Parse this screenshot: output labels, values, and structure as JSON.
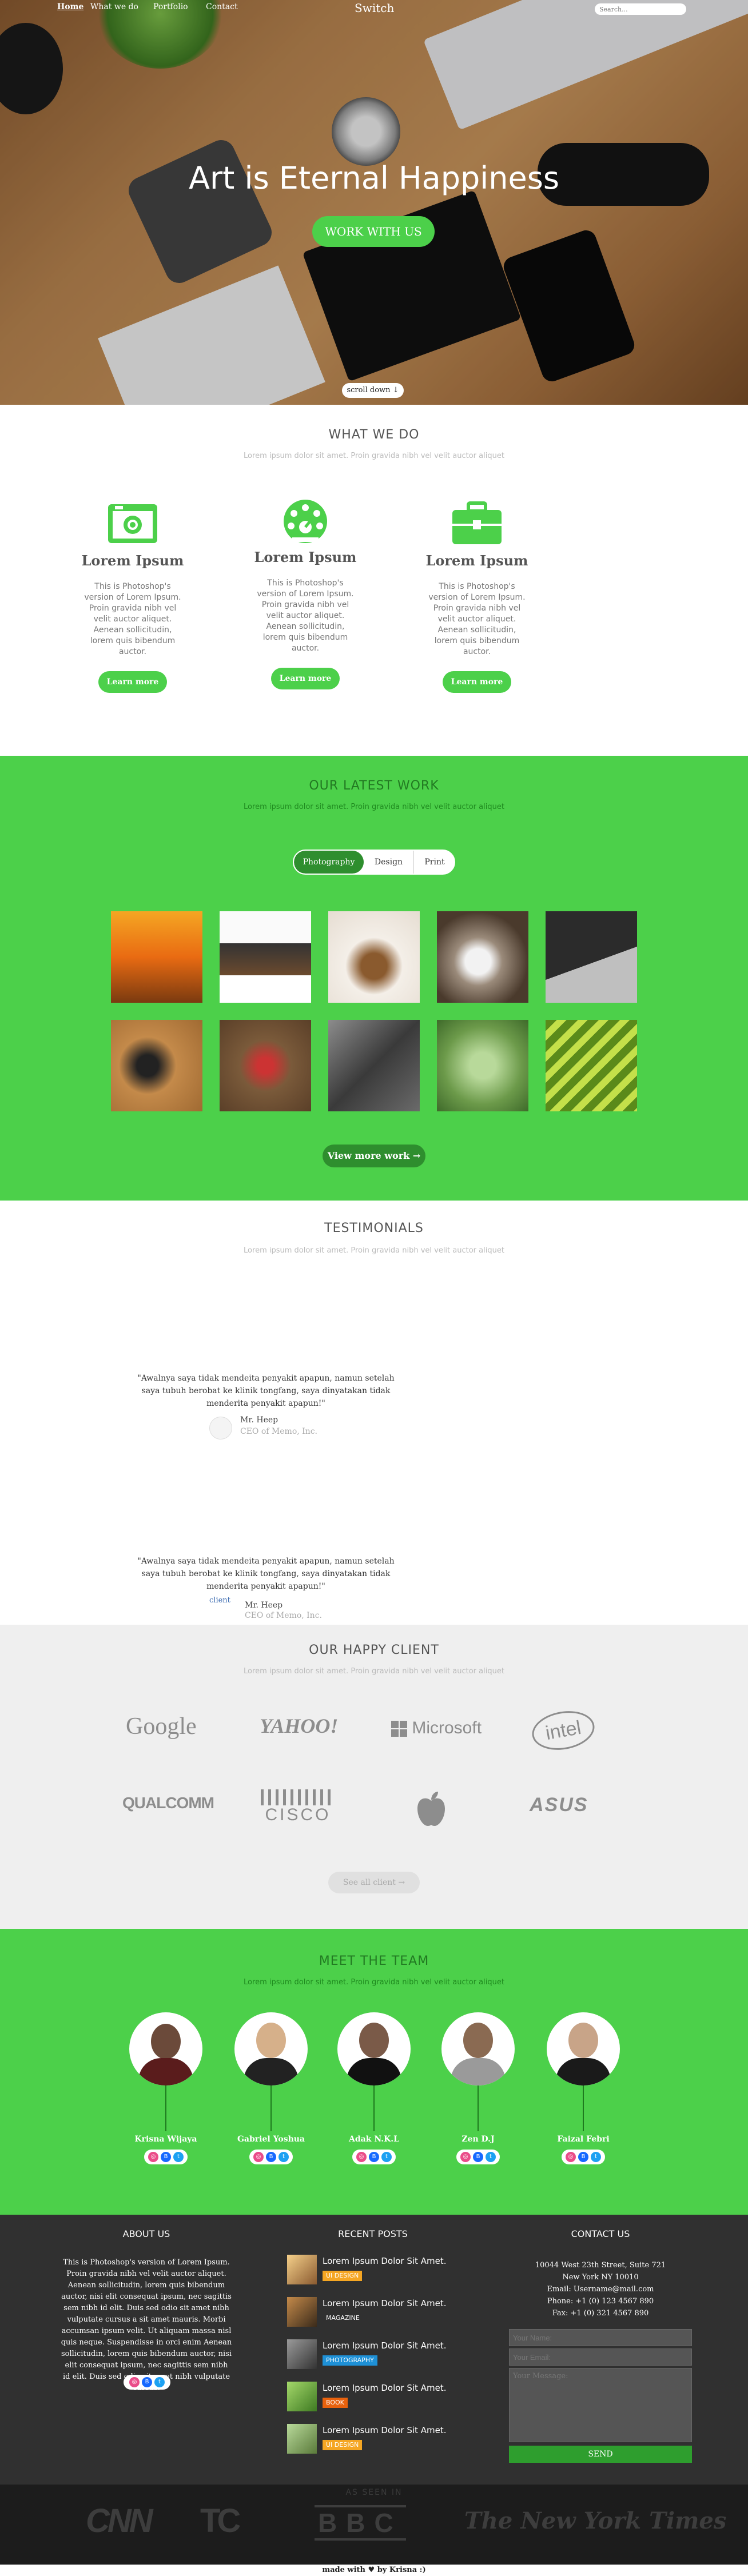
{
  "nav": {
    "links": [
      "Home",
      "What we do",
      "Portfolio",
      "Contact"
    ],
    "brand": "Switch",
    "search_placeholder": "Search..."
  },
  "hero": {
    "title": "Art is Eternal Happiness",
    "cta": "WORK WITH US",
    "scroll": "scroll down ↓"
  },
  "what_we_do": {
    "title": "WHAT WE DO",
    "subtitle": "Lorem ipsum dolor sit amet. Proin gravida nibh vel velit auctor aliquet",
    "services": [
      {
        "icon": "camera-icon",
        "title": "Lorem Ipsum",
        "text": "This is Photoshop's version of Lorem Ipsum. Proin gravida nibh vel velit auctor aliquet. Aenean sollicitudin, lorem quis bibendum auctor.",
        "button": "Learn more"
      },
      {
        "icon": "palette-icon",
        "title": "Lorem Ipsum",
        "text": "This is Photoshop's version of Lorem Ipsum. Proin gravida nibh vel velit auctor aliquet. Aenean sollicitudin, lorem quis bibendum auctor.",
        "button": "Learn more"
      },
      {
        "icon": "briefcase-icon",
        "title": "Lorem Ipsum",
        "text": "This is Photoshop's version of Lorem Ipsum. Proin gravida nibh vel velit auctor aliquet. Aenean sollicitudin, lorem quis bibendum auctor.",
        "button": "Learn more"
      }
    ]
  },
  "work": {
    "title": "OUR LATEST WORK",
    "subtitle": "Lorem ipsum dolor sit amet. Proin gravida nibh vel velit auctor aliquet",
    "filters": [
      "Photography",
      "Design",
      "Print"
    ],
    "active_filter": "Photography",
    "view_more": "View more work →"
  },
  "testimonials": {
    "title": "TESTIMONIALS",
    "subtitle": "Lorem ipsum dolor sit amet. Proin gravida nibh vel velit auctor aliquet",
    "items": [
      {
        "quote": "\"Awalnya saya tidak mendeita penyakit apapun, namun setelah saya tubuh berobat ke klinik tongfang, saya dinyatakan tidak menderita penyakit apapun!\"",
        "author": "Mr. Heep",
        "role": "CEO of Memo, Inc."
      },
      {
        "quote": "\"Awalnya saya tidak mendeita penyakit apapun, namun setelah saya tubuh berobat ke klinik tongfang, saya dinyatakan tidak menderita penyakit apapun!\"",
        "author": "Mr. Heep",
        "role": "CEO of Memo, Inc.",
        "image_alt": "client"
      }
    ]
  },
  "clients": {
    "title": "OUR HAPPY CLIENT",
    "subtitle": "Lorem ipsum dolor sit amet. Proin gravida nibh vel velit auctor aliquet",
    "logos": [
      "Google",
      "YAHOO!",
      "Microsoft",
      "intel",
      "QUALCOMM",
      "CISCO",
      "apple",
      "ASUS"
    ],
    "see_all": "See all client →"
  },
  "team": {
    "title": "MEET THE TEAM",
    "subtitle": "Lorem ipsum dolor sit amet. Proin gravida nibh vel velit auctor aliquet",
    "members": [
      "Krisna Wijaya",
      "Gabriel Yoshua",
      "Adak N.K.L",
      "Zen D.J",
      "Faizal Febri"
    ]
  },
  "footer": {
    "about_title": "ABOUT US",
    "about_text": "This is Photoshop's version of Lorem Ipsum. Proin gravida nibh vel velit auctor aliquet. Aenean sollicitudin, lorem quis bibendum auctor, nisi elit consequat ipsum, nec sagittis sem nibh id elit. Duis sed odio sit amet nibh vulputate cursus a sit amet mauris. Morbi accumsan ipsum velit. Ut aliquam massa nisl quis neque. Suspendisse in orci enim Aenean sollicitudin, lorem quis bibendum auctor, nisi elit consequat ipsum, nec sagittis sem nibh id elit. Duis sed odio sit amet nibh vulputate cursus.",
    "posts_title": "RECENT POSTS",
    "posts": [
      {
        "title": "Lorem Ipsum Dolor Sit Amet.",
        "tag": "UI DESIGN",
        "tag_color": "#f5a623"
      },
      {
        "title": "Lorem Ipsum Dolor Sit Amet.",
        "tag": "MAGAZINE",
        "tag_color": "#303030"
      },
      {
        "title": "Lorem Ipsum Dolor Sit Amet.",
        "tag": "PHOTOGRAPHY",
        "tag_color": "#1e90d6"
      },
      {
        "title": "Lorem Ipsum Dolor Sit Amet.",
        "tag": "BOOK",
        "tag_color": "#e8620e"
      },
      {
        "title": "Lorem Ipsum Dolor Sit Amet.",
        "tag": "UI DESIGN",
        "tag_color": "#f5a623"
      }
    ],
    "contact_title": "CONTACT US",
    "contact_lines": [
      "10044 West 23th Street, Suite 721",
      "New York NY 10010",
      "Email: Username@mail.com",
      "Phone: +1 (0) 123 4567 890",
      "Fax: +1 (0) 321 4567 890"
    ],
    "name_placeholder": "Your Name:",
    "email_placeholder": "Your Email:",
    "message_placeholder": "Your Message:",
    "send": "SEND"
  },
  "featured": {
    "label": "as seen in",
    "logos": [
      "CNN",
      "TC",
      "BBC",
      "The New York Times"
    ]
  },
  "made_with": "made with ♥ by Krisna :)"
}
